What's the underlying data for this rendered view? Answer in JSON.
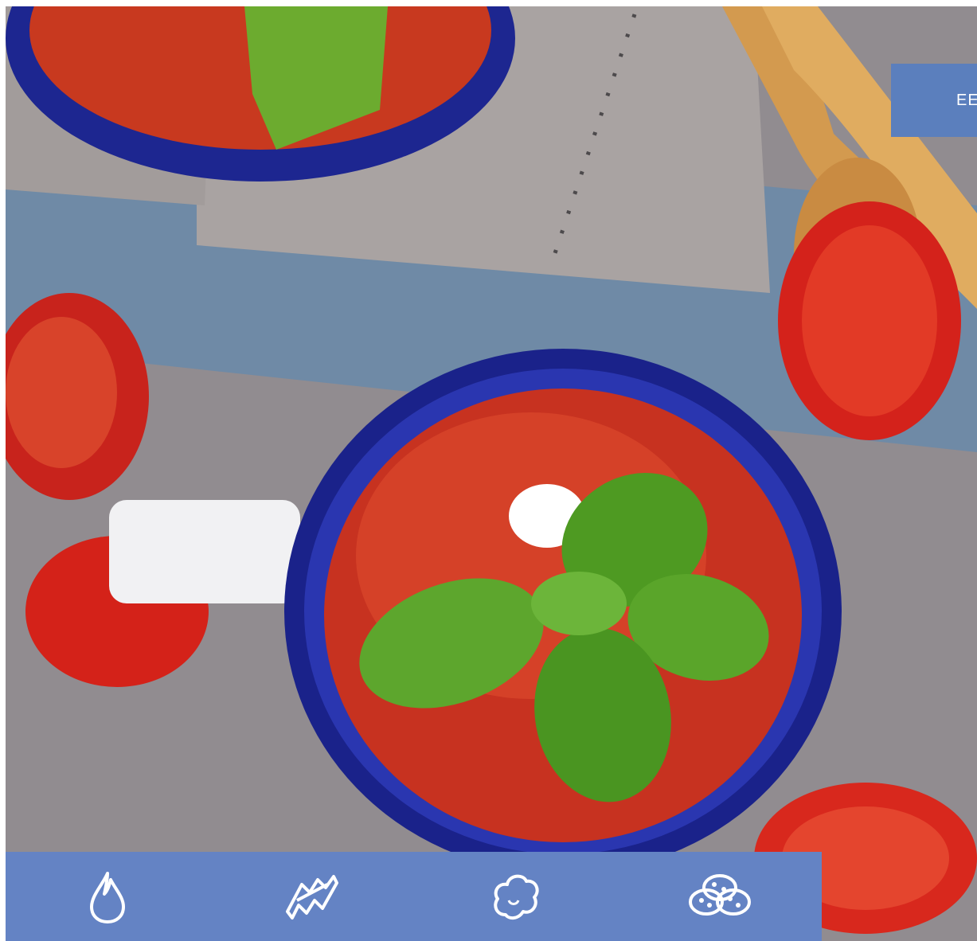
{
  "hero": {
    "image": "tomato-soup-photo"
  },
  "header": {
    "cta_label": "EE"
  },
  "icon_bar": {
    "items": [
      {
        "icon": "drop-icon"
      },
      {
        "icon": "pasta-icon"
      },
      {
        "icon": "cloud-icon"
      },
      {
        "icon": "cookies-icon"
      }
    ]
  },
  "colors": {
    "accent": "#6483c4",
    "button": "#5b7fbd"
  }
}
